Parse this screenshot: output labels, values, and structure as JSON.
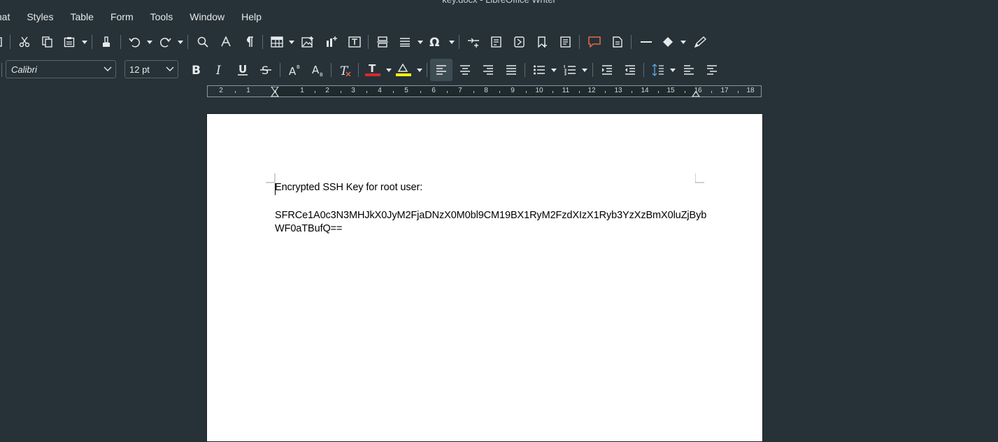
{
  "window": {
    "title": "key.docx - LibreOffice Writer"
  },
  "menu": [
    "mat",
    "Styles",
    "Table",
    "Form",
    "Tools",
    "Window",
    "Help"
  ],
  "formatting": {
    "font_name": "Calibri",
    "font_size": "12 pt",
    "font_color_swatch": "#d9282f",
    "highlight_swatch": "#ffff00"
  },
  "ruler": {
    "labels": [
      "2",
      "1",
      "1",
      "2",
      "3",
      "4",
      "5",
      "6",
      "7",
      "8",
      "9",
      "10",
      "11",
      "12",
      "13",
      "14",
      "15",
      "16",
      "17",
      "18"
    ]
  },
  "document": {
    "line1": "Encrypted SSH Key for root user:",
    "line2": "SFRCe1A0c3N3MHJkX0JyM2FjaDNzX0M0bl9CM19BX1RyM2FzdXIzX1Ryb3YzXzBmX0luZjByb",
    "line3": "WF0aTBufQ=="
  }
}
